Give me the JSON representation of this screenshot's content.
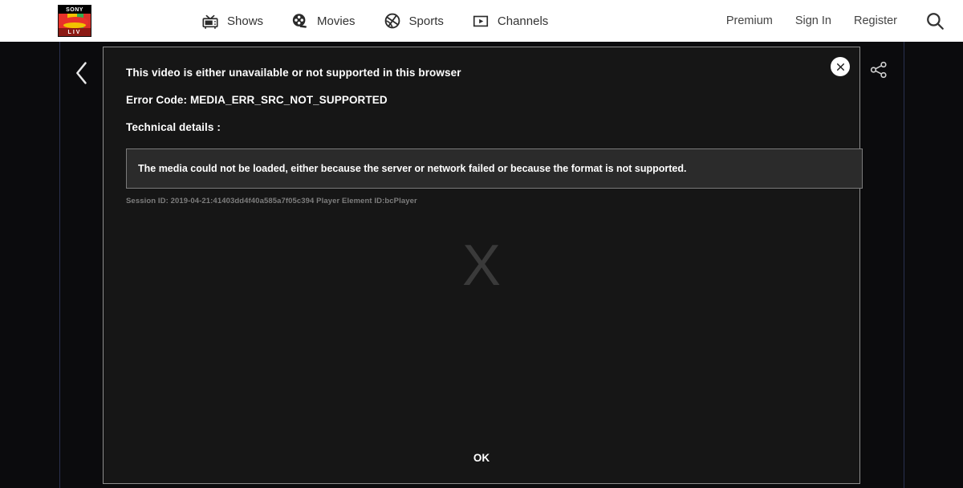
{
  "header": {
    "logo": {
      "name": "sony-liv-logo",
      "top_text": "SONY",
      "bottom_text": "LIV"
    },
    "nav": [
      {
        "label": "Shows",
        "icon": "tv-icon"
      },
      {
        "label": "Movies",
        "icon": "film-reel-icon"
      },
      {
        "label": "Sports",
        "icon": "basketball-icon"
      },
      {
        "label": "Channels",
        "icon": "play-box-icon"
      }
    ],
    "links": [
      {
        "label": "Premium"
      },
      {
        "label": "Sign In"
      },
      {
        "label": "Register"
      }
    ],
    "search_icon": "search-icon"
  },
  "stage": {
    "back_icon": "chevron-left-icon",
    "share_icon": "share-icon"
  },
  "player": {
    "watermark": "X",
    "close_icon": "close-icon",
    "error_title": "This video is either unavailable or not supported in this browser",
    "error_code": "Error Code: MEDIA_ERR_SRC_NOT_SUPPORTED",
    "technical_label": "Technical details :",
    "technical_details": "The media could not be loaded, either because the server or network failed or because the format is not supported.",
    "session_info": "Session ID: 2019-04-21:41403dd4f40a585a7f05c394 Player Element ID:bcPlayer",
    "ok_label": "OK"
  },
  "colors": {
    "page_bg": "#0b0b0d",
    "header_bg": "#ffffff",
    "player_bg": "#161616",
    "tech_box_bg": "#2b2b2b",
    "rail": "#2a3150",
    "accent_red": "#e8322a"
  }
}
